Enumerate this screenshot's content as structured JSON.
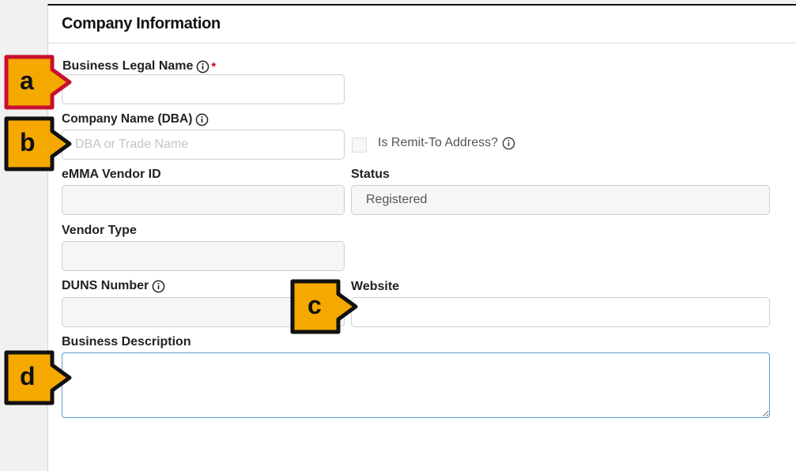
{
  "card": {
    "title": "Company Information"
  },
  "fields": {
    "business_legal_name": {
      "label": "Business Legal Name",
      "required_mark": "*",
      "value": ""
    },
    "company_name_dba": {
      "label": "Company Name (DBA)",
      "placeholder": "DBA or Trade Name",
      "value": ""
    },
    "remit_to": {
      "label": "Is Remit-To Address?",
      "checked": false
    },
    "emma_vendor_id": {
      "label": "eMMA Vendor ID",
      "value": ""
    },
    "status": {
      "label": "Status",
      "value": "Registered"
    },
    "vendor_type": {
      "label": "Vendor Type",
      "value": ""
    },
    "duns_number": {
      "label": "DUNS Number",
      "value": ""
    },
    "website": {
      "label": "Website",
      "value": ""
    },
    "business_description": {
      "label": "Business Description",
      "value": ""
    }
  },
  "callouts": {
    "a": {
      "letter": "a",
      "color": "#f5a800",
      "border": "#c8102e"
    },
    "b": {
      "letter": "b",
      "color": "#f5a800",
      "border": "#111111"
    },
    "c": {
      "letter": "c",
      "color": "#f5a800",
      "border": "#111111"
    },
    "d": {
      "letter": "d",
      "color": "#f5a800",
      "border": "#111111"
    }
  },
  "icons": {
    "info": "info-circle-icon",
    "resize": "resize-handle-icon"
  }
}
